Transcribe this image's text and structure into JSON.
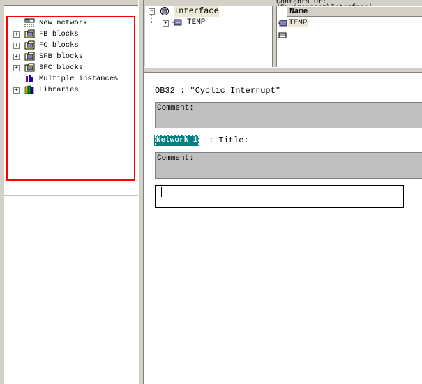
{
  "catalog": {
    "items": [
      {
        "label": "New network",
        "icon": "new-network-icon",
        "expandable": false
      },
      {
        "label": "FB blocks",
        "icon": "fb-blocks-icon",
        "expandable": true
      },
      {
        "label": "FC blocks",
        "icon": "fc-blocks-icon",
        "expandable": true
      },
      {
        "label": "SFB blocks",
        "icon": "sfb-blocks-icon",
        "expandable": true
      },
      {
        "label": "SFC blocks",
        "icon": "sfc-blocks-icon",
        "expandable": true
      },
      {
        "label": "Multiple instances",
        "icon": "multiple-instances-icon",
        "expandable": false
      },
      {
        "label": "Libraries",
        "icon": "libraries-icon",
        "expandable": true
      }
    ]
  },
  "interface": {
    "root_label": "Interface",
    "child_label": "TEMP"
  },
  "contents": {
    "header_text": "Contents Of: 'Environment\\Interface'",
    "name_column": "Name",
    "rows": [
      "TEMP"
    ]
  },
  "editor": {
    "block_title": "OB32 :  \"Cyclic Interrupt\"",
    "block_comment_label": "Comment:",
    "network_label": "Network 1",
    "network_title": ": Title:",
    "network_comment_label": "Comment:"
  },
  "colors": {
    "highlight": "#ff0000",
    "network_label_bg": "#008080",
    "comment_bg": "#c0c0c0"
  }
}
